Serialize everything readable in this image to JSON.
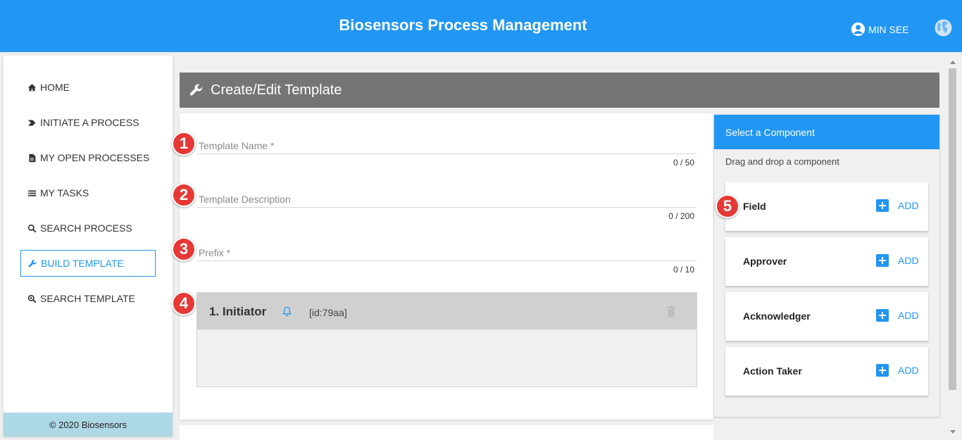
{
  "header": {
    "title": "Biosensors Process Management",
    "user_name": "MIN SEE",
    "user_icon": "account-circle-icon",
    "language_icon": "globe-icon"
  },
  "sidebar": {
    "items": [
      {
        "label": "HOME",
        "icon": "home-icon",
        "active": false
      },
      {
        "label": "INITIATE A PROCESS",
        "icon": "chevron-right-icon",
        "active": false
      },
      {
        "label": "MY OPEN PROCESSES",
        "icon": "file-icon",
        "active": false
      },
      {
        "label": "MY TASKS",
        "icon": "list-icon",
        "active": false
      },
      {
        "label": "SEARCH PROCESS",
        "icon": "search-icon",
        "active": false
      },
      {
        "label": "BUILD TEMPLATE",
        "icon": "wrench-icon",
        "active": true
      },
      {
        "label": "SEARCH TEMPLATE",
        "icon": "search-plus-icon",
        "active": false
      }
    ],
    "footer": "© 2020 Biosensors"
  },
  "page": {
    "title": "Create/Edit Template",
    "title_icon": "wrench-icon"
  },
  "form": {
    "fields": [
      {
        "label": "Template Name *",
        "value": "",
        "counter": "0 / 50",
        "badge": "1"
      },
      {
        "label": "Template Description",
        "value": "",
        "counter": "0 / 200",
        "badge": "2"
      },
      {
        "label": "Prefix *",
        "value": "",
        "counter": "0 / 10",
        "badge": "3"
      }
    ],
    "initiator": {
      "badge": "4",
      "title": "1. Initiator",
      "id": "[id:79aa]",
      "notify_icon": "bell-icon",
      "delete_icon": "trash-icon"
    }
  },
  "components": {
    "title": "Select a Component",
    "subtitle": "Drag and drop a component",
    "badge": "5",
    "items": [
      {
        "name": "Field",
        "add_label": "ADD"
      },
      {
        "name": "Approver",
        "add_label": "ADD"
      },
      {
        "name": "Acknowledger",
        "add_label": "ADD"
      },
      {
        "name": "Action Taker",
        "add_label": "ADD"
      }
    ]
  },
  "colors": {
    "primary": "#2196f3",
    "header_gray": "#757575",
    "badge_red": "#e53935",
    "footer_blue": "#add8e6"
  }
}
